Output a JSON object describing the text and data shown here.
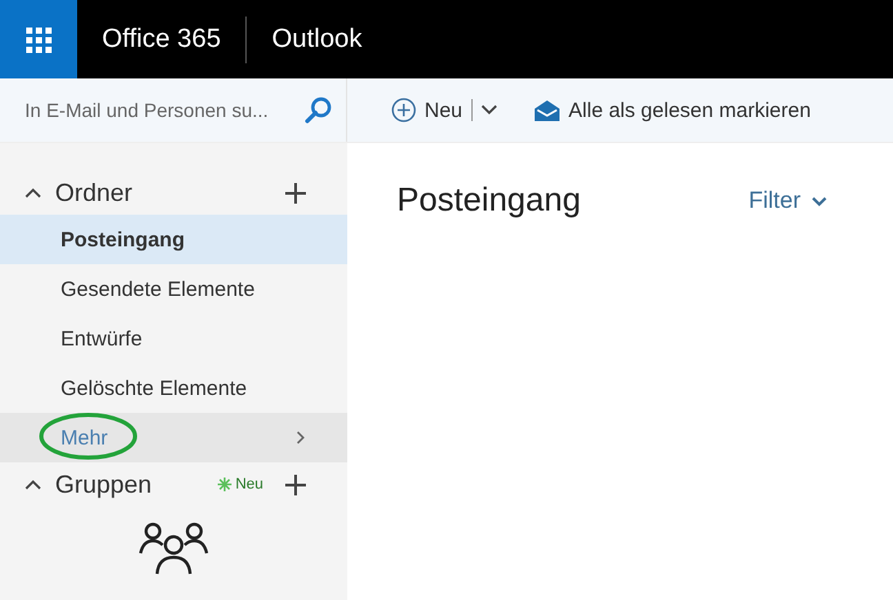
{
  "top_bar": {
    "brand": "Office 365",
    "app": "Outlook"
  },
  "search": {
    "placeholder": "In E-Mail und Personen su..."
  },
  "toolbar": {
    "new_label": "Neu",
    "mark_read_label": "Alle als gelesen markieren"
  },
  "sidebar": {
    "folders_header": {
      "label": "Ordner",
      "expanded": true
    },
    "items": [
      {
        "kind": "folder",
        "label": "Posteingang",
        "selected": true,
        "hovered": false,
        "circled": false
      },
      {
        "kind": "folder",
        "label": "Gesendete Elemente",
        "selected": false,
        "hovered": false,
        "circled": false
      },
      {
        "kind": "folder",
        "label": "Entwürfe",
        "selected": false,
        "hovered": false,
        "circled": false
      },
      {
        "kind": "folder",
        "label": "Gelöschte Elemente",
        "selected": false,
        "hovered": false,
        "circled": false
      },
      {
        "kind": "more",
        "label": "Mehr",
        "selected": false,
        "hovered": true,
        "circled": true
      }
    ],
    "groups_header": {
      "label": "Gruppen",
      "expanded": true,
      "badge": "Neu"
    }
  },
  "mail_list": {
    "title": "Posteingang",
    "filter_label": "Filter"
  }
}
